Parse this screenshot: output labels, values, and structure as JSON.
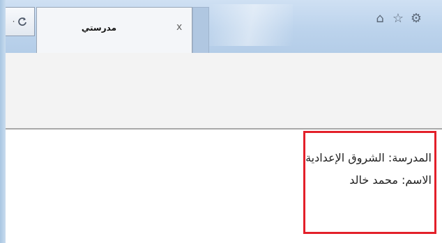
{
  "tab": {
    "title": "مدرستي",
    "close_label": "x"
  },
  "refresh": {
    "dots": "·"
  },
  "toolbar": {
    "icons": [
      "home-icon",
      "star-icon",
      "gear-icon"
    ],
    "home_glyph": "⌂",
    "star_glyph": "☆",
    "gear_glyph": "⚙"
  },
  "page": {
    "school_line": "المدرسة: الشروق الإعدادية",
    "name_line": "الاسم: محمد خالد"
  },
  "colors": {
    "highlight_border": "#e3202a",
    "titlebar": "#bcd3ec"
  }
}
